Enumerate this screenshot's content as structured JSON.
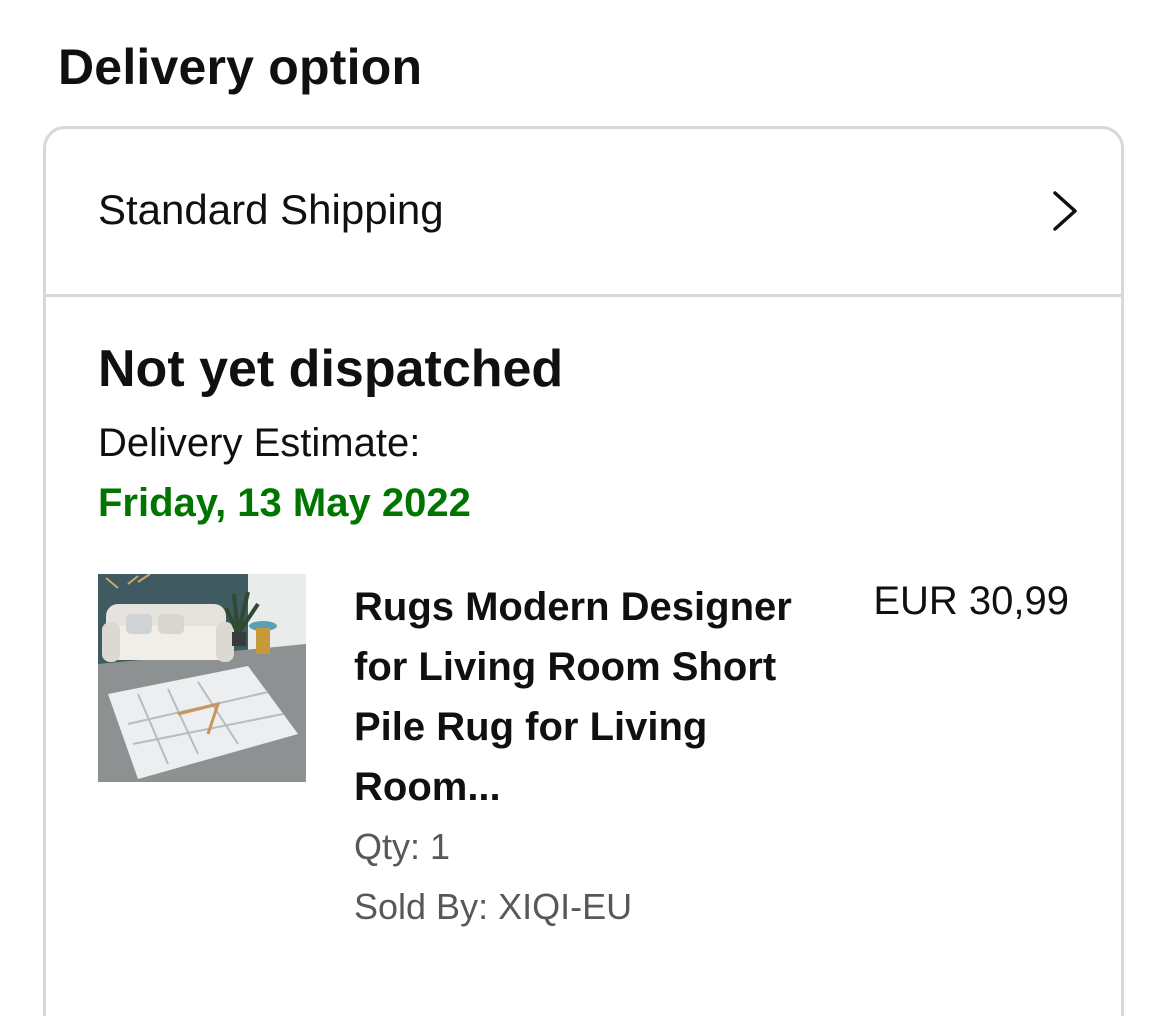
{
  "section": {
    "title": "Delivery option"
  },
  "shipping": {
    "label": "Standard Shipping",
    "icon": "chevron-right-icon"
  },
  "shipment": {
    "status": "Not yet dispatched",
    "estimate_label": "Delivery Estimate:",
    "estimate_date": "Friday, 13 May 2022",
    "estimate_color": "#007600"
  },
  "item": {
    "title": "Rugs Modern Designer for Living Room Short Pile Rug for Living Room...",
    "price": "EUR 30,99",
    "qty": "Qty: 1",
    "sold_by": "Sold By: XIQI-EU",
    "image": "rug-product-image"
  }
}
